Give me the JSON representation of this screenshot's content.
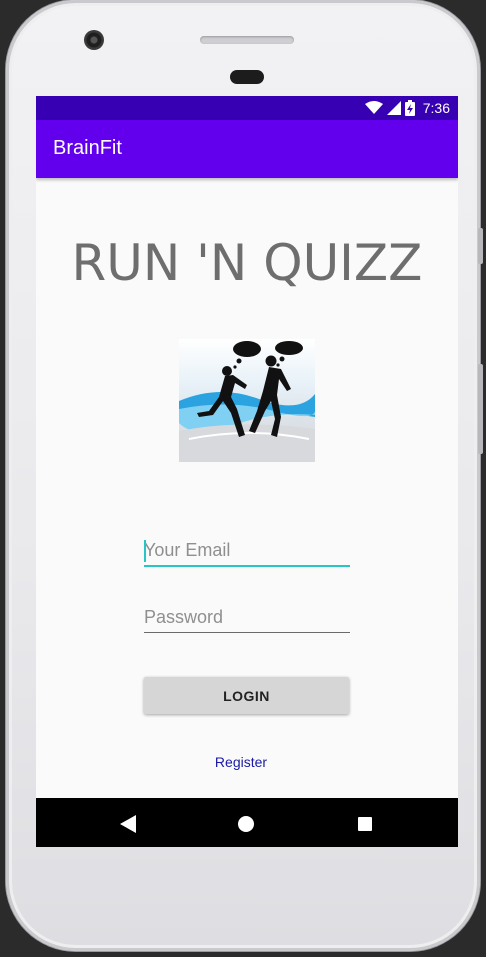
{
  "status_bar": {
    "time": "7:36",
    "icons": [
      "wifi-icon",
      "signal-icon",
      "battery-charging-icon"
    ]
  },
  "app_bar": {
    "title": "BrainFit"
  },
  "main": {
    "headline": "RUN 'N QUIZZ",
    "logo_image": "runners-with-thought-bubbles",
    "email": {
      "value": "",
      "placeholder": "Your Email"
    },
    "password": {
      "value": "",
      "placeholder": "Password"
    },
    "login_label": "LOGIN",
    "register_label": "Register"
  },
  "nav_bar": {
    "icons": [
      "back-icon",
      "home-icon",
      "recents-icon"
    ]
  },
  "colors": {
    "status_bar": "#3700b3",
    "app_bar": "#6200ee",
    "accent": "#26c6c6",
    "link": "#1a1aa6"
  }
}
